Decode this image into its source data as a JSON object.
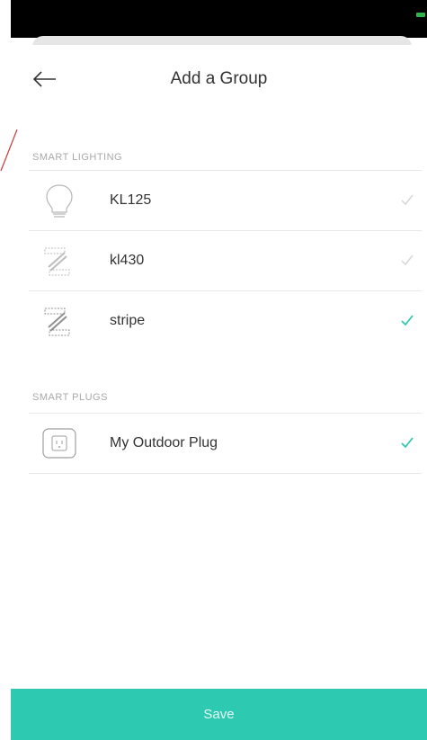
{
  "header": {
    "title": "Add a Group"
  },
  "sections": [
    {
      "label": "SMART LIGHTING",
      "items": [
        {
          "name": "KL125",
          "icon": "bulb-icon",
          "selected": false
        },
        {
          "name": "kl430",
          "icon": "light-strip-icon",
          "selected": false
        },
        {
          "name": "stripe",
          "icon": "light-strip-icon",
          "selected": true
        }
      ]
    },
    {
      "label": "SMART PLUGS",
      "items": [
        {
          "name": "My Outdoor Plug",
          "icon": "plug-icon",
          "selected": true
        }
      ]
    }
  ],
  "footer": {
    "save_label": "Save"
  },
  "colors": {
    "accent": "#2ec9b1",
    "check_selected": "#35c6b0",
    "check_unselected": "#d6d6d6",
    "battery": "#2fb34a"
  }
}
